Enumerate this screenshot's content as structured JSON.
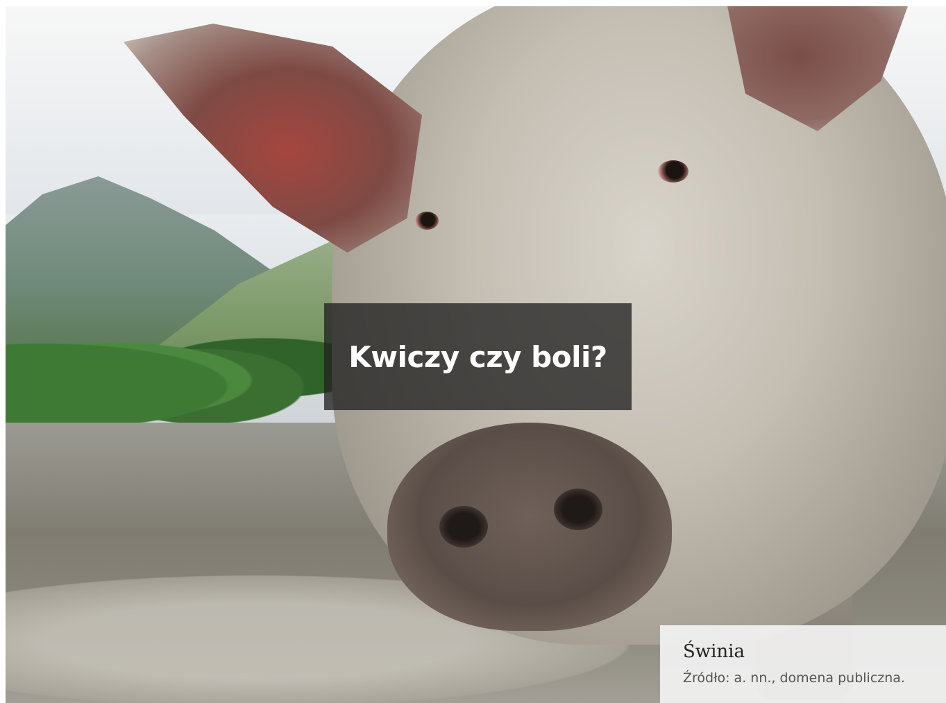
{
  "overlay": {
    "title": "Kwiczy czy boli?"
  },
  "caption": {
    "title": "Świnia",
    "source": "Źródło: a. nn., domena publiczna."
  },
  "colors": {
    "title_box_background": "#222222",
    "title_text": "#ffffff",
    "caption_background": "#f2f2f2"
  }
}
